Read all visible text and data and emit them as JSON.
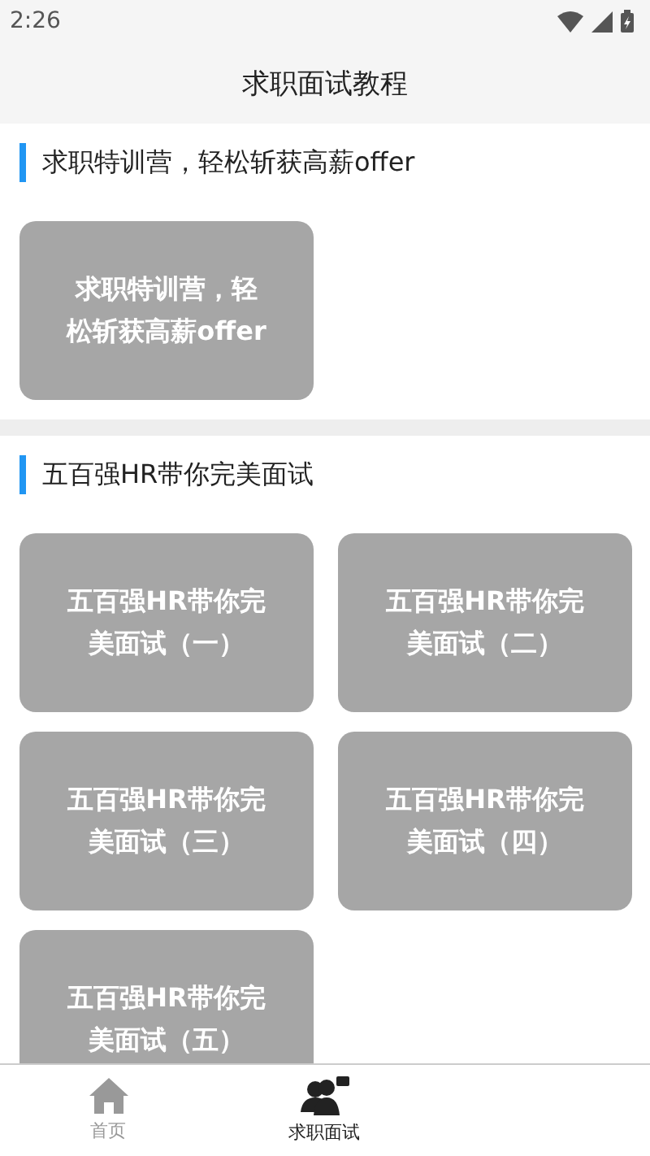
{
  "status_bar": {
    "time": "2:26"
  },
  "title": "求职面试教程",
  "sections": [
    {
      "heading": "求职特训营，轻松斩获高薪offer",
      "cards": [
        {
          "label": "求职特训营，轻松斩获高薪offer"
        }
      ]
    },
    {
      "heading": "五百强HR带你完美面试",
      "cards": [
        {
          "label": "五百强HR带你完美面试（一）"
        },
        {
          "label": "五百强HR带你完美面试（二）"
        },
        {
          "label": "五百强HR带你完美面试（三）"
        },
        {
          "label": "五百强HR带你完美面试（四）"
        },
        {
          "label": "五百强HR带你完美面试（五）"
        }
      ]
    }
  ],
  "tabs": [
    {
      "label": "首页",
      "kind": "home",
      "selected": false
    },
    {
      "label": "求职面试",
      "kind": "people",
      "selected": true
    }
  ]
}
